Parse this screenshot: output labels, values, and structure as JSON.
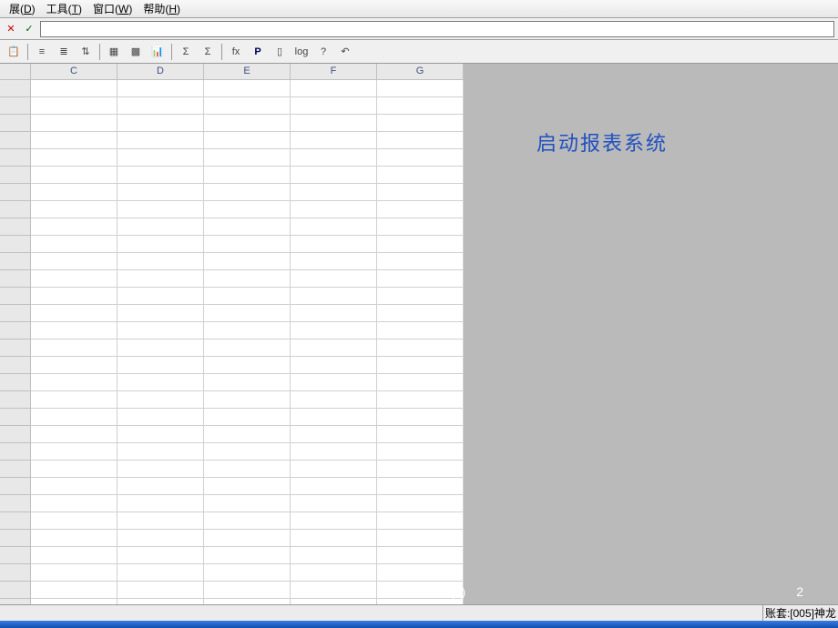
{
  "menu": {
    "items": [
      {
        "label": "展",
        "key": "D"
      },
      {
        "label": "工具",
        "key": "T"
      },
      {
        "label": "窗口",
        "key": "W"
      },
      {
        "label": "帮助",
        "key": "H"
      }
    ]
  },
  "formula_bar": {
    "cancel_icon": "✕",
    "confirm_icon": "✓",
    "value": ""
  },
  "toolbar": {
    "buttons": [
      {
        "name": "paste-icon",
        "glyph": "📋"
      },
      {
        "name": "sep"
      },
      {
        "name": "align-left-icon",
        "glyph": "≡"
      },
      {
        "name": "align-center-icon",
        "glyph": "≣"
      },
      {
        "name": "sort-icon",
        "glyph": "⇅"
      },
      {
        "name": "sep"
      },
      {
        "name": "grid1-icon",
        "glyph": "▦"
      },
      {
        "name": "grid2-icon",
        "glyph": "▩"
      },
      {
        "name": "chart-icon",
        "glyph": "📊"
      },
      {
        "name": "sep"
      },
      {
        "name": "sigma-icon",
        "glyph": "Σ"
      },
      {
        "name": "sigma2-icon",
        "glyph": "Σ"
      },
      {
        "name": "sep"
      },
      {
        "name": "func-icon",
        "glyph": "fx"
      },
      {
        "name": "p-icon",
        "glyph": "P",
        "bold": true
      },
      {
        "name": "doc-icon",
        "glyph": "▯"
      },
      {
        "name": "log-icon",
        "glyph": "log"
      },
      {
        "name": "help-icon",
        "glyph": "?"
      },
      {
        "name": "undo-icon",
        "glyph": "↶"
      }
    ]
  },
  "spreadsheet": {
    "columns": [
      "C",
      "D",
      "E",
      "F",
      "G"
    ],
    "row_count": 31
  },
  "side_panel": {
    "title": "启动报表系统"
  },
  "footer": {
    "left_text": "统(2)",
    "right_text": "2"
  },
  "statusbar": {
    "account": "账套:[005]神龙"
  }
}
